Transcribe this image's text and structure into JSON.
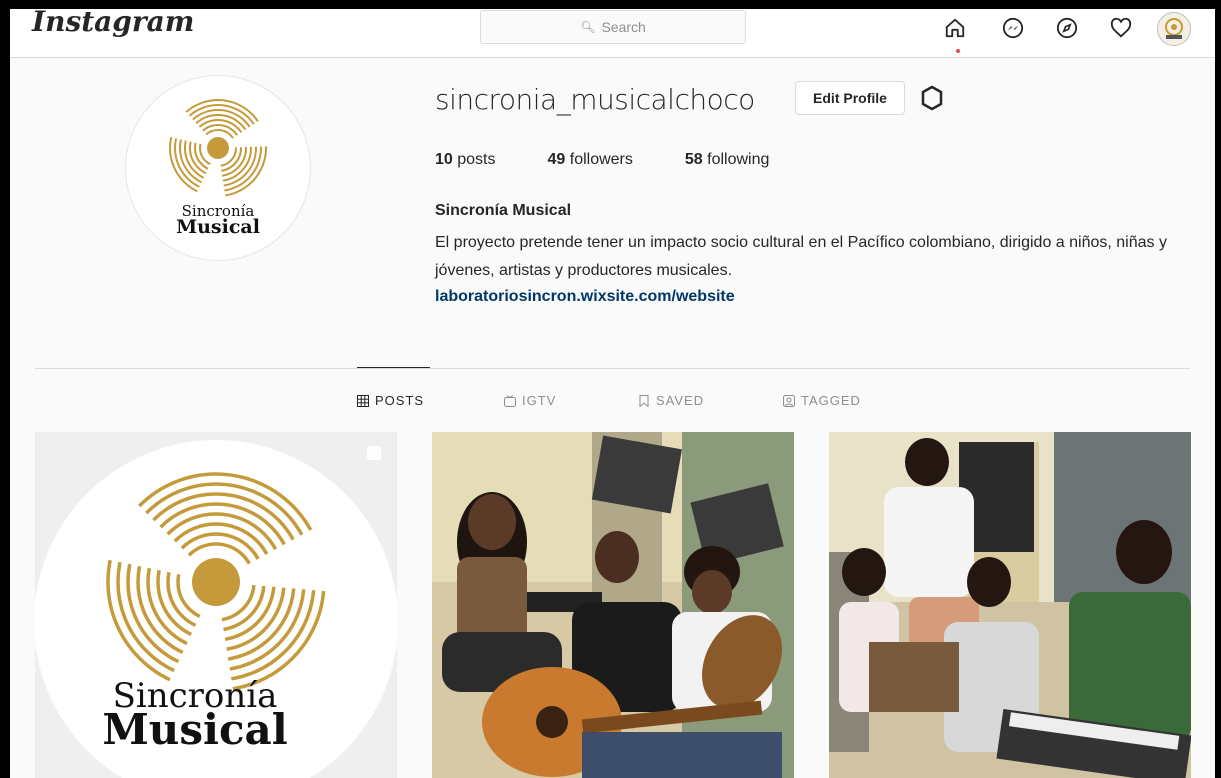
{
  "topbar": {
    "logo": "Instagram",
    "search_placeholder": "Search",
    "icons": [
      "home-icon",
      "messenger-icon",
      "explore-icon",
      "heart-icon",
      "profile-avatar"
    ]
  },
  "profile": {
    "username": "sincronia_musicalchoco",
    "edit_label": "Edit Profile",
    "stats": {
      "posts_count": "10",
      "posts_label": "posts",
      "followers_count": "49",
      "followers_label": "followers",
      "following_count": "58",
      "following_label": "following"
    },
    "full_name": "Sincronía Musical",
    "bio": "El proyecto pretende tener un impacto socio cultural en el Pacífico colombiano, dirigido a niños, niñas y jóvenes, artistas y productores musicales.",
    "link": "laboratoriosincron.wixsite.com/website",
    "logo_text_1": "Sincronía",
    "logo_text_2": "Musical"
  },
  "tabs": [
    {
      "label": "POSTS",
      "active": true
    },
    {
      "label": "IGTV",
      "active": false
    },
    {
      "label": "SAVED",
      "active": false
    },
    {
      "label": "TAGGED",
      "active": false
    }
  ],
  "colors": {
    "gold": "#c49a3a",
    "link": "#00376b",
    "text": "#262626",
    "muted": "#8e8e8e",
    "notification": "#ed4956"
  }
}
